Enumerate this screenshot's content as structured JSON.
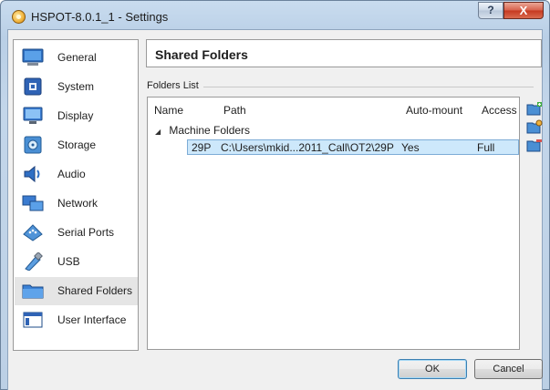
{
  "window": {
    "title": "HSPOT-8.0.1_1 - Settings",
    "help_label": "?",
    "close_label": "X"
  },
  "sidebar": {
    "items": [
      {
        "label": "General",
        "icon": "general-icon"
      },
      {
        "label": "System",
        "icon": "system-icon"
      },
      {
        "label": "Display",
        "icon": "display-icon"
      },
      {
        "label": "Storage",
        "icon": "storage-icon"
      },
      {
        "label": "Audio",
        "icon": "audio-icon"
      },
      {
        "label": "Network",
        "icon": "network-icon"
      },
      {
        "label": "Serial Ports",
        "icon": "serial-ports-icon"
      },
      {
        "label": "USB",
        "icon": "usb-icon"
      },
      {
        "label": "Shared Folders",
        "icon": "shared-folders-icon",
        "selected": true
      },
      {
        "label": "User Interface",
        "icon": "user-interface-icon"
      }
    ]
  },
  "main": {
    "title": "Shared Folders",
    "group_label": "Folders List",
    "table": {
      "columns": [
        "Name",
        "Path",
        "Auto-mount",
        "Access"
      ],
      "group": "Machine Folders",
      "rows": [
        {
          "name": "29P",
          "path": "C:\\Users\\mkid...2011_Call\\OT2\\29P",
          "auto_mount": "Yes",
          "access": "Full"
        }
      ]
    },
    "tools": [
      "add-folder-icon",
      "edit-folder-icon",
      "remove-folder-icon"
    ]
  },
  "buttons": {
    "ok": "OK",
    "cancel": "Cancel"
  },
  "colors": {
    "selection": "#cde8fb",
    "frame": "#bcd0e5",
    "close": "#c5381f"
  }
}
